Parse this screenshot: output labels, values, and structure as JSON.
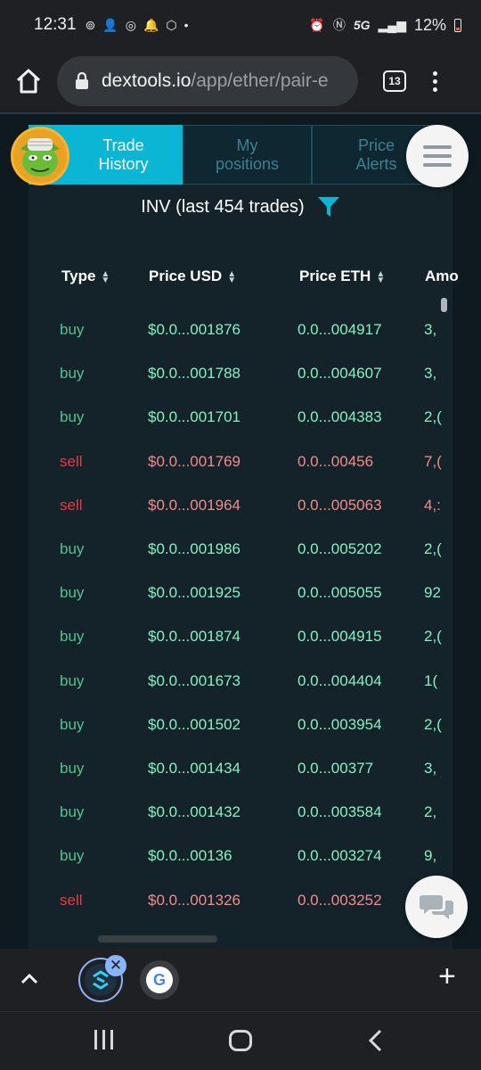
{
  "status_bar": {
    "time": "12:31",
    "network": "5G",
    "battery": "12%"
  },
  "browser": {
    "url_host": "dextools.io",
    "url_path": "/app/ether/pair-e",
    "tab_count": "13"
  },
  "tabs": [
    {
      "label_line1": "Trade",
      "label_line2": "History",
      "active": true
    },
    {
      "label_line1": "My",
      "label_line2": "positions",
      "active": false
    },
    {
      "label_line1": "Price",
      "label_line2": "Alerts",
      "active": false
    }
  ],
  "trades_title": "INV (last 454 trades)",
  "table": {
    "headers": [
      "Type",
      "Price USD",
      "Price ETH",
      "Amo"
    ],
    "rows": [
      {
        "type": "buy",
        "usd": "$0.0...001876",
        "eth": "0.0...004917",
        "amt": "3,"
      },
      {
        "type": "buy",
        "usd": "$0.0...001788",
        "eth": "0.0...004607",
        "amt": "3,"
      },
      {
        "type": "buy",
        "usd": "$0.0...001701",
        "eth": "0.0...004383",
        "amt": "2,("
      },
      {
        "type": "sell",
        "usd": "$0.0...001769",
        "eth": "0.0...00456",
        "amt": "7,("
      },
      {
        "type": "sell",
        "usd": "$0.0...001964",
        "eth": "0.0...005063",
        "amt": "4,:"
      },
      {
        "type": "buy",
        "usd": "$0.0...001986",
        "eth": "0.0...005202",
        "amt": "2,("
      },
      {
        "type": "buy",
        "usd": "$0.0...001925",
        "eth": "0.0...005055",
        "amt": "92"
      },
      {
        "type": "buy",
        "usd": "$0.0...001874",
        "eth": "0.0...004915",
        "amt": "2,("
      },
      {
        "type": "buy",
        "usd": "$0.0...001673",
        "eth": "0.0...004404",
        "amt": "1("
      },
      {
        "type": "buy",
        "usd": "$0.0...001502",
        "eth": "0.0...003954",
        "amt": "2,("
      },
      {
        "type": "buy",
        "usd": "$0.0...001434",
        "eth": "0.0...00377",
        "amt": "3,"
      },
      {
        "type": "buy",
        "usd": "$0.0...001432",
        "eth": "0.0...003584",
        "amt": "2,"
      },
      {
        "type": "buy",
        "usd": "$0.0...00136",
        "eth": "0.0...003274",
        "amt": "9,"
      },
      {
        "type": "sell",
        "usd": "$0.0...001326",
        "eth": "0.0...003252",
        "amt": ""
      }
    ]
  },
  "tab_strip": {
    "google_letter": "G",
    "plus": "+"
  },
  "colors": {
    "accent": "#0ab6d3",
    "buy": "#52c48a",
    "sell": "#ea3943"
  }
}
